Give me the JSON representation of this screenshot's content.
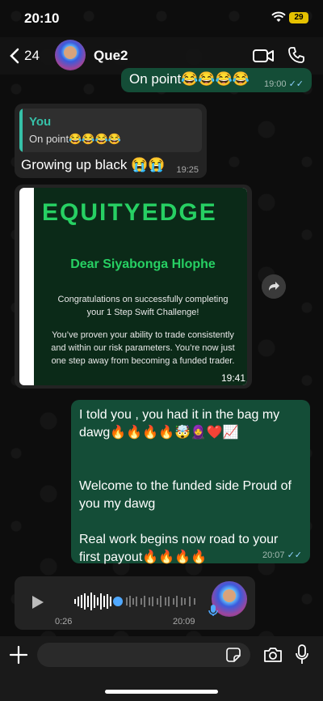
{
  "status": {
    "time": "20:10",
    "battery": "29"
  },
  "header": {
    "back_count": "24",
    "contact_name": "Que2"
  },
  "messages": {
    "m1": {
      "text": "On point😂😂😂😂",
      "time": "19:00",
      "ticks": "✓✓"
    },
    "m2": {
      "quote_author": "You",
      "quote_text": "On point😂😂😂😂",
      "text": "Growing up black 😭😭",
      "time": "19:25"
    },
    "m3": {
      "brand": "EQUITYEDGE",
      "dear": "Dear Siyabonga Hlophe",
      "para1": "Congratulations on successfully completing your 1 Step Swift Challenge!",
      "para2": "You’ve proven your ability to trade consistently and within our risk parameters. You’re now just one step away from becoming a funded trader.",
      "time": "19:41"
    },
    "m4": {
      "text": "I told you , you had it in the bag my dawg🔥🔥🔥🔥🤯🧕❤️📈\n\n\nWelcome to the funded side Proud of you my dawg\n\nReal work begins now road to your first payout🔥🔥🔥🔥",
      "time": "20:07",
      "ticks": "✓✓"
    },
    "m5": {
      "duration": "0:26",
      "time": "20:09"
    }
  },
  "composer": {
    "placeholder": ""
  },
  "icons": {
    "back": "chevron-left-icon",
    "video": "video-call-icon",
    "phone": "phone-icon",
    "share": "forward-icon",
    "play": "play-icon",
    "plus": "plus-icon",
    "sticker": "sticker-icon",
    "camera": "camera-icon",
    "mic": "microphone-icon"
  },
  "colors": {
    "outgoing_bubble": "#144d37",
    "incoming_bubble": "#232323",
    "quote_accent": "#36c0a8",
    "brand_green": "#27d063",
    "read_ticks": "#8fd2ff"
  }
}
